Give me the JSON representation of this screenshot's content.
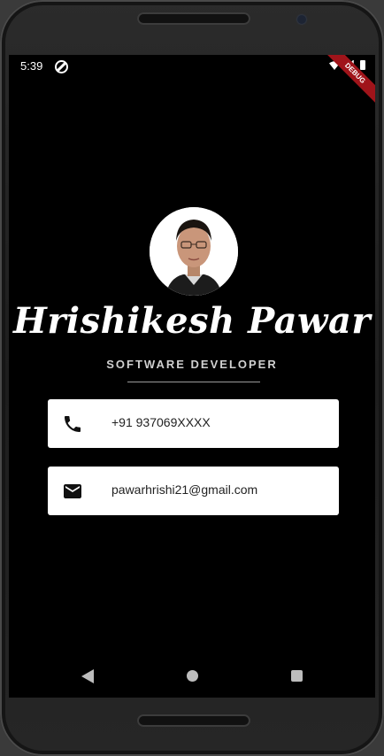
{
  "status_bar": {
    "time": "5:39",
    "sync_icon": "sync-disabled-icon",
    "wifi_icon": "wifi-icon",
    "signal_icon": "signal-icon",
    "battery_icon": "battery-icon",
    "debug_banner": "DEBUG"
  },
  "profile": {
    "name": "Hrishikesh Pawar",
    "role": "SOFTWARE DEVELOPER"
  },
  "contacts": [
    {
      "icon": "phone-icon",
      "value": "+91 937069XXXX"
    },
    {
      "icon": "mail-icon",
      "value": "pawarhrishi21@gmail.com"
    }
  ],
  "navigation": {
    "back": "back-icon",
    "home": "home-icon",
    "recents": "recents-icon"
  },
  "colors": {
    "background": "#000000",
    "card": "#ffffff",
    "text_primary": "#ffffff",
    "text_secondary": "#d0d0d0",
    "debug": "#a0141a"
  }
}
